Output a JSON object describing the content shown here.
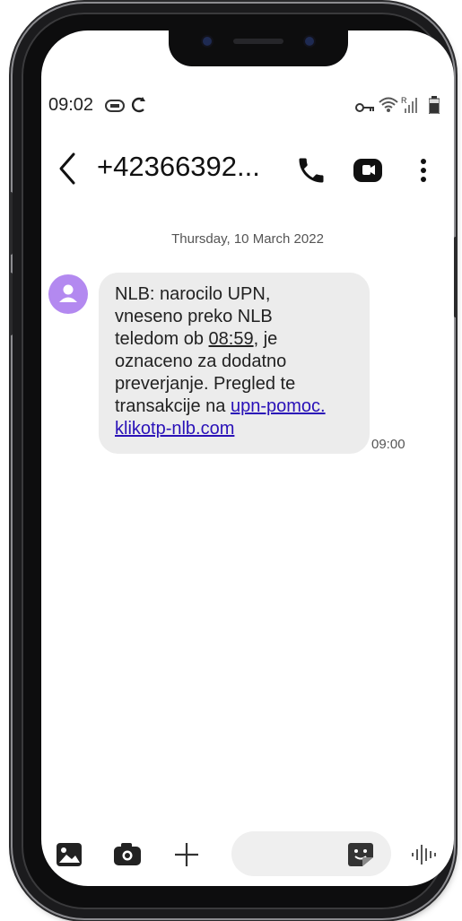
{
  "status_bar": {
    "time": "09:02",
    "left_icons": [
      "screen-cast-icon",
      "sync-icon"
    ],
    "right_icons": [
      "vpn-key-icon",
      "wifi-icon",
      "signal-icon",
      "battery-icon"
    ]
  },
  "conversation": {
    "contact": "+42366392...",
    "actions": [
      "back-icon",
      "phone-icon",
      "video-call-icon",
      "more-vertical-icon"
    ]
  },
  "thread": {
    "date": "Thursday, 10 March 2022",
    "message": {
      "sender_icon": "person-icon",
      "text_lines": [
        "NLB: narocilo UPN,",
        "vneseno preko NLB",
        "teledom ob ",
        "08:59",
        ", je",
        "oznaceno za dodatno",
        "preverjanje. Pregled te",
        "transakcije na ",
        "upn-pomoc.",
        "klikotp-nlb.com"
      ],
      "time": "09:00"
    }
  },
  "composer": {
    "input_value": "",
    "buttons": [
      "gallery-icon",
      "camera-icon",
      "plus-icon",
      "sticker-icon",
      "voice-icon"
    ]
  },
  "colors": {
    "avatar": "#b389f0",
    "bubble": "#ececec",
    "link": "#2a12b8",
    "frame": "#1b1b1d"
  }
}
